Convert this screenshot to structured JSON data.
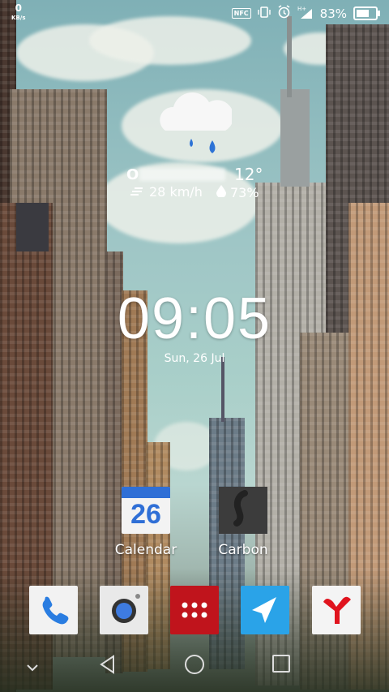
{
  "status_bar": {
    "net_speed": "0",
    "net_unit": "KB/s",
    "battery_percent": "83%",
    "battery_level": 0.83,
    "icons": [
      "nfc-icon",
      "vibrate-icon",
      "alarm-icon",
      "signal-hplus-icon"
    ]
  },
  "weather": {
    "city": "O",
    "temperature": "12°",
    "wind": "28 km/h",
    "humidity": "73%",
    "icon": "rain-cloud-icon"
  },
  "clock": {
    "time": "09:05",
    "date": "Sun, 26 Jul"
  },
  "apps": {
    "calendar": {
      "label": "Calendar",
      "day": "26"
    },
    "carbon": {
      "label": "Carbon"
    }
  },
  "dock": [
    "phone-icon",
    "camera-icon",
    "apps-drawer-icon",
    "telegram-icon",
    "yandex-browser-icon"
  ],
  "nav": [
    "collapse-chevron-icon",
    "back-icon",
    "home-icon",
    "recents-icon"
  ],
  "colors": {
    "calendar_blue": "#2f6fd6",
    "phone_blue": "#2a7de1",
    "drawer_red": "#c0141c",
    "telegram_blue": "#2aa3e8",
    "yandex_red": "#e0141e"
  }
}
